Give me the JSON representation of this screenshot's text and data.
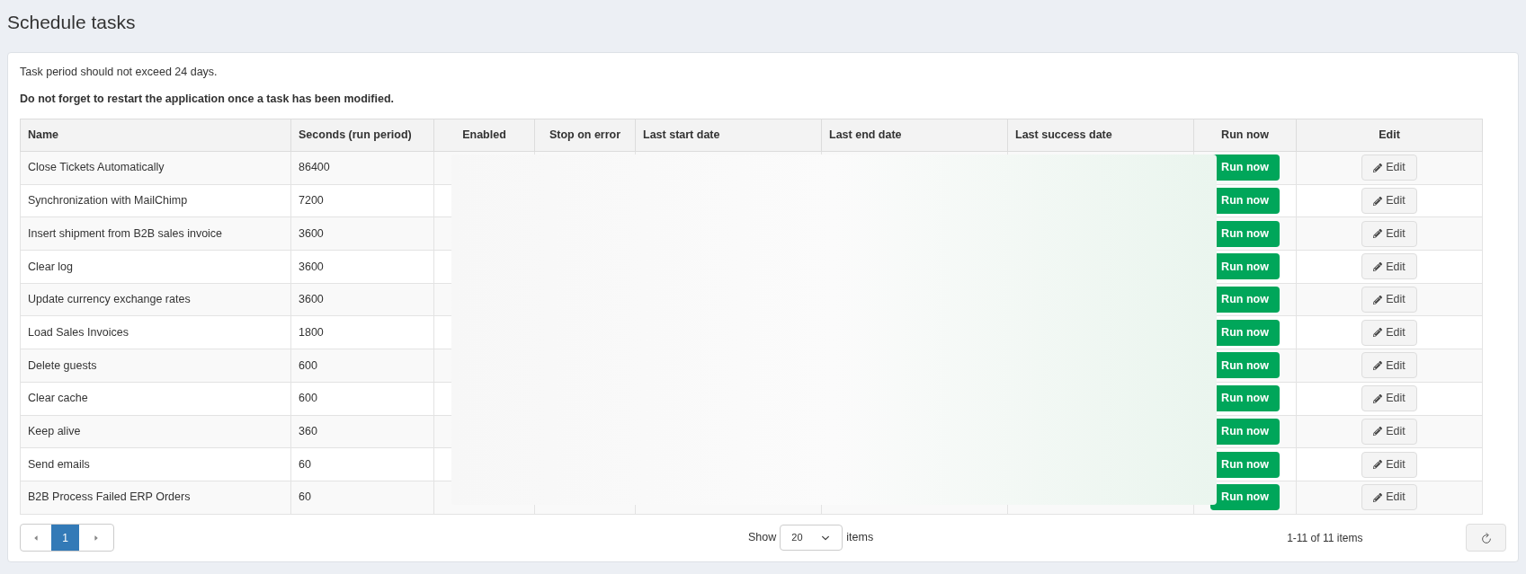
{
  "page_title": "Schedule tasks",
  "notes": [
    "Task period should not exceed 24 days.",
    "**Do not forget to restart the application once a task has been modified.**"
  ],
  "table": {
    "columns": [
      {
        "label": "Name"
      },
      {
        "label": "Seconds (run period)"
      },
      {
        "label": "Enabled"
      },
      {
        "label": "Stop on error"
      },
      {
        "label": "Last start date"
      },
      {
        "label": "Last end date"
      },
      {
        "label": "Last success date"
      },
      {
        "label": "Run now"
      },
      {
        "label": "Edit"
      }
    ],
    "rows": [
      {
        "name": "Close Tickets Automatically",
        "seconds": "86400",
        "run_label": "Run now",
        "edit_label": "Edit"
      },
      {
        "name": "Synchronization with MailChimp",
        "seconds": "7200",
        "run_label": "Run now",
        "edit_label": "Edit"
      },
      {
        "name": "Insert shipment from B2B sales invoice",
        "seconds": "3600",
        "run_label": "Run now",
        "edit_label": "Edit"
      },
      {
        "name": "Clear log",
        "seconds": "3600",
        "run_label": "Run now",
        "edit_label": "Edit"
      },
      {
        "name": "Update currency exchange rates",
        "seconds": "3600",
        "run_label": "Run now",
        "edit_label": "Edit"
      },
      {
        "name": "Load Sales Invoices",
        "seconds": "1800",
        "run_label": "Run now",
        "edit_label": "Edit"
      },
      {
        "name": "Delete guests",
        "seconds": "600",
        "run_label": "Run now",
        "edit_label": "Edit"
      },
      {
        "name": "Clear cache",
        "seconds": "600",
        "run_label": "Run now",
        "edit_label": "Edit"
      },
      {
        "name": "Keep alive",
        "seconds": "360",
        "run_label": "Run now",
        "edit_label": "Edit"
      },
      {
        "name": "Send emails",
        "seconds": "60",
        "run_label": "Run now",
        "edit_label": "Edit"
      },
      {
        "name": "B2B Process Failed ERP Orders",
        "seconds": "60",
        "run_label": "Run now",
        "edit_label": "Edit"
      }
    ]
  },
  "pager": {
    "pages": [
      {
        "label": "1",
        "selected": true
      }
    ],
    "show_label": "Show",
    "page_size": "20",
    "items_label": "items",
    "summary": "1-11 of 11 items"
  }
}
